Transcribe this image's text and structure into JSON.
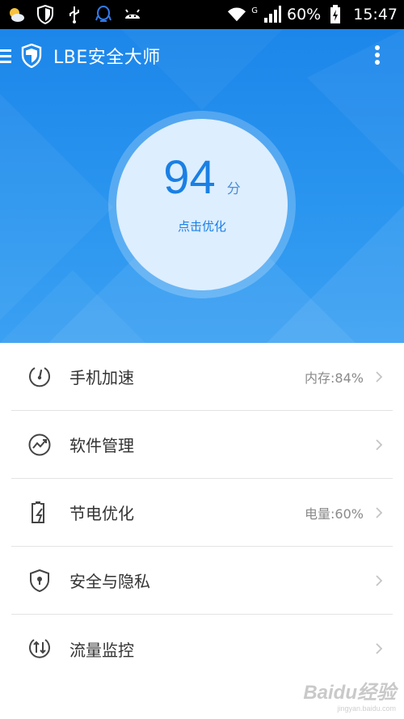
{
  "status_bar": {
    "battery_text": "60%",
    "time": "15:47",
    "network_label": "G",
    "icons": [
      "weather-icon",
      "shield-notification-icon",
      "usb-icon",
      "qq-icon",
      "android-icon",
      "wifi-icon",
      "signal-icon",
      "battery-charging-icon"
    ]
  },
  "app": {
    "title": "LBE安全大师",
    "accent_color": "#1c86ea"
  },
  "score": {
    "value": "94",
    "unit": "分",
    "action": "点击优化"
  },
  "features": [
    {
      "label": "手机加速",
      "value": "内存:84%",
      "icon": "speedometer-icon"
    },
    {
      "label": "软件管理",
      "value": "",
      "icon": "trend-chart-icon"
    },
    {
      "label": "节电优化",
      "value": "电量:60%",
      "icon": "battery-bolt-icon"
    },
    {
      "label": "安全与隐私",
      "value": "",
      "icon": "shield-lock-icon"
    },
    {
      "label": "流量监控",
      "value": "",
      "icon": "data-traffic-icon"
    }
  ],
  "watermark": {
    "brand": "Baidu经验",
    "url": "jingyan.baidu.com"
  }
}
